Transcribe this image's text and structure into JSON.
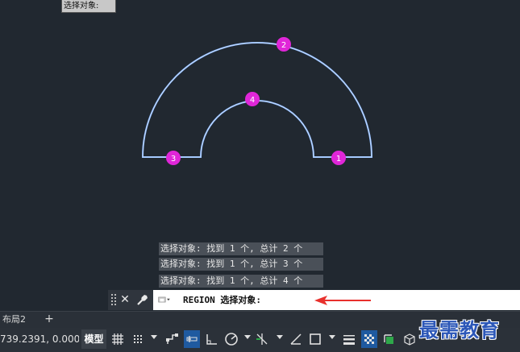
{
  "tooltip": {
    "text": "选择对象:"
  },
  "markers": [
    {
      "label": "1"
    },
    {
      "label": "2"
    },
    {
      "label": "3"
    },
    {
      "label": "4"
    }
  ],
  "command_history": [
    "选择对象: 找到 1 个, 总计 2 个",
    "选择对象: 找到 1 个, 总计 3 个",
    "选择对象: 找到 1 个, 总计 4 个"
  ],
  "command_line": {
    "text": "REGION 选择对象:",
    "close_icon": "close-icon",
    "customize_icon": "wrench-icon"
  },
  "layout_tabs": {
    "current": "布局2",
    "add": "+"
  },
  "status_bar": {
    "coordinates": "739.2391, 0.0000",
    "model_label": "模型"
  },
  "watermark": "最需教育",
  "colors": {
    "background": "#212830",
    "shape_outline": "#8ab8ff",
    "marker": "#e026d8",
    "arrow": "#e8302c",
    "active_toggle": "#1f5aa0"
  }
}
